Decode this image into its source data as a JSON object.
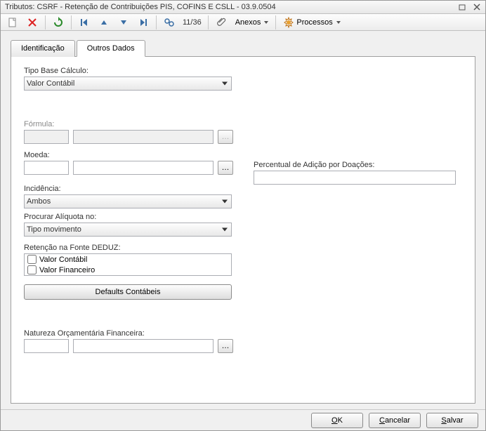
{
  "window": {
    "title": "Tributos: CSRF - Retenção de Contribuições PIS, COFINS E CSLL - 03.9.0504"
  },
  "toolbar": {
    "counter": "11/36",
    "anexos_label": "Anexos",
    "processos_label": "Processos"
  },
  "tabs": {
    "identificacao": "Identificação",
    "outros_dados": "Outros Dados"
  },
  "form": {
    "tipo_base_label": "Tipo Base Cálculo:",
    "tipo_base_value": "Valor Contábil",
    "formula_label": "Fórmula:",
    "moeda_label": "Moeda:",
    "incidencia_label": "Incidência:",
    "incidencia_value": "Ambos",
    "procurar_label": "Procurar Alíquota no:",
    "procurar_value": "Tipo movimento",
    "retencao_label": "Retenção na Fonte DEDUZ:",
    "retencao_opt1": "Valor Contábil",
    "retencao_opt2": "Valor Financeiro",
    "defaults_btn": "Defaults Contábeis",
    "natureza_label": "Natureza Orçamentária Financeira:",
    "percentual_label": "Percentual de Adição por Doações:"
  },
  "footer": {
    "ok": "OK",
    "cancelar": "Cancelar",
    "salvar": "Salvar"
  }
}
